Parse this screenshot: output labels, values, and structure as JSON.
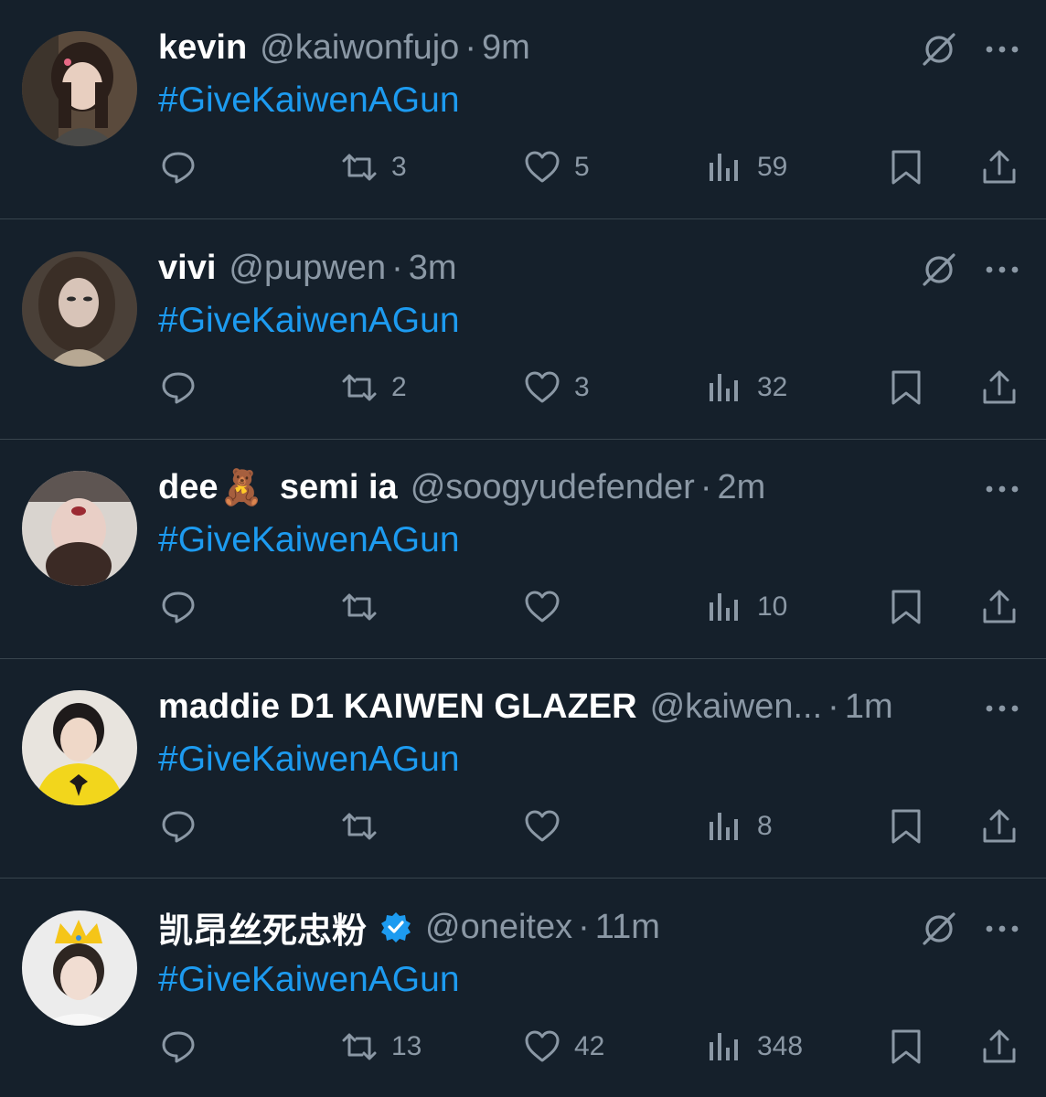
{
  "tweets": [
    {
      "name": "kevin",
      "name_suffix": "",
      "emoji": "",
      "handle": "@kaiwonfujo",
      "separator": "·",
      "time": "9m",
      "text": "#GiveKaiwenAGun",
      "verified": false,
      "muted_icon": true,
      "counts": {
        "retweets": "3",
        "likes": "5",
        "views": "59"
      },
      "avatar_colors": {
        "bg": "#5a4a3c",
        "face": "#e8cfc0",
        "hair": "#2b1f1a"
      }
    },
    {
      "name": "vivi",
      "name_suffix": "",
      "emoji": "",
      "handle": "@pupwen",
      "separator": "·",
      "time": "3m",
      "text": "#GiveKaiwenAGun",
      "verified": false,
      "muted_icon": true,
      "counts": {
        "retweets": "2",
        "likes": "3",
        "views": "32"
      },
      "avatar_colors": {
        "bg": "#4a4038",
        "face": "#d8c4b8",
        "hair": "#3a2e26"
      }
    },
    {
      "name": "dee",
      "name_suffix": "semi ia",
      "emoji": "🧸",
      "handle": "@soogyudefender",
      "separator": "·",
      "time": "2m",
      "text": "#GiveKaiwenAGun",
      "verified": false,
      "muted_icon": false,
      "counts": {
        "retweets": "",
        "likes": "",
        "views": "10"
      },
      "avatar_colors": {
        "bg": "#d9d4cf",
        "face": "#e9cfc6",
        "hair": "#3b2a25"
      }
    },
    {
      "name": "maddie D1 KAIWEN GLAZER",
      "name_suffix": "",
      "emoji": "",
      "handle": "@kaiwen...",
      "separator": "·",
      "time": "1m",
      "text": "#GiveKaiwenAGun",
      "verified": false,
      "muted_icon": false,
      "counts": {
        "retweets": "",
        "likes": "",
        "views": "8"
      },
      "avatar_colors": {
        "bg": "#e8e4de",
        "face": "#efd8c8",
        "hair": "#1e1a1a",
        "shirt": "#f2d61c"
      }
    },
    {
      "name": "凯昂丝死忠粉",
      "name_suffix": "",
      "emoji": "",
      "handle": "@oneitex",
      "separator": "·",
      "time": "11m",
      "text": "#GiveKaiwenAGun",
      "verified": true,
      "muted_icon": true,
      "counts": {
        "retweets": "13",
        "likes": "42",
        "views": "348"
      },
      "avatar_colors": {
        "bg": "#ececec",
        "face": "#f1ddd2",
        "hair": "#2e2622",
        "crown": "#f5c518"
      }
    }
  ],
  "colors": {
    "background": "#15202b",
    "divider": "#38444d",
    "muted_text": "#8b98a5",
    "link": "#1d9bf0",
    "verified": "#1d9bf0"
  }
}
